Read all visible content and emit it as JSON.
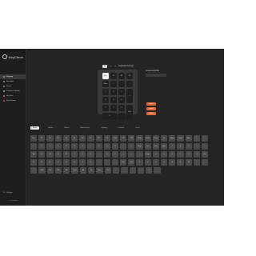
{
  "app": {
    "title": "KeyChron",
    "subtitle": "· · ·",
    "footer": "Connected"
  },
  "sidebar": {
    "items": [
      {
        "label": "Keymap",
        "active": true
      },
      {
        "label": "Backlight",
        "active": false
      },
      {
        "label": "Macro",
        "active": false
      },
      {
        "label": "Firmware Update",
        "active": false
      },
      {
        "label": "Key Test",
        "active": false
      },
      {
        "label": "Key Remap",
        "active": false
      }
    ],
    "settings_label": "Settings"
  },
  "toolbar": {
    "layer": "L0",
    "profile": "Keyboard Settings"
  },
  "numpad": {
    "keys": [
      {
        "label": "Esc",
        "selected": true,
        "tall": false,
        "wide": false
      },
      {
        "label": "F1",
        "selected": false,
        "tall": false,
        "wide": false
      },
      {
        "label": "F2",
        "selected": false,
        "tall": false,
        "wide": false
      },
      {
        "label": "F3",
        "selected": false,
        "tall": false,
        "wide": false
      },
      {
        "label": "Num",
        "selected": false,
        "tall": false,
        "wide": false
      },
      {
        "label": "/",
        "selected": false,
        "tall": false,
        "wide": false
      },
      {
        "label": "*",
        "selected": false,
        "tall": false,
        "wide": false
      },
      {
        "label": "-",
        "selected": false,
        "tall": false,
        "wide": false
      },
      {
        "label": "7",
        "selected": false,
        "tall": false,
        "wide": false
      },
      {
        "label": "8",
        "selected": false,
        "tall": false,
        "wide": false
      },
      {
        "label": "9",
        "selected": false,
        "tall": false,
        "wide": false
      },
      {
        "label": "+",
        "selected": false,
        "tall": true,
        "wide": false
      },
      {
        "label": "4",
        "selected": false,
        "tall": false,
        "wide": false
      },
      {
        "label": "5",
        "selected": false,
        "tall": false,
        "wide": false
      },
      {
        "label": "6",
        "selected": false,
        "tall": false,
        "wide": false
      },
      {
        "label": "1",
        "selected": false,
        "tall": false,
        "wide": false
      },
      {
        "label": "2",
        "selected": false,
        "tall": false,
        "wide": false
      },
      {
        "label": "3",
        "selected": false,
        "tall": false,
        "wide": false
      },
      {
        "label": "Ent",
        "selected": false,
        "tall": true,
        "wide": false
      },
      {
        "label": "0",
        "selected": false,
        "tall": false,
        "wide": true
      },
      {
        "label": ".",
        "selected": false,
        "tall": false,
        "wide": false
      }
    ]
  },
  "right_panel": {
    "label": "Current keycode",
    "buttons": [
      "Reset",
      "Import",
      "Export"
    ]
  },
  "tabs": [
    "Basic",
    "Media",
    "Macro",
    "Special Key",
    "Lighting",
    "Custom",
    "Layer"
  ],
  "keyboard": {
    "rows": [
      [
        "Esc",
        "F1",
        "F2",
        "F3",
        "F4",
        "F5",
        "F6",
        "F7",
        "F8",
        "F9",
        "F10",
        "F11",
        "F12",
        "PrtSc",
        "ScrLk",
        "Pause",
        "Ins",
        "Home",
        "PgUp",
        "Num",
        "/",
        "*"
      ],
      [
        "`",
        "1",
        "2",
        "3",
        "4",
        "5",
        "6",
        "7",
        "8",
        "9",
        "0",
        "-",
        "=",
        "Bksp",
        "Del",
        "End",
        "PgDn",
        "7",
        "8",
        "9",
        "-",
        "+"
      ],
      [
        "Tab",
        "Q",
        "W",
        "E",
        "R",
        "T",
        "Y",
        "U",
        "I",
        "O",
        "P",
        "[",
        "]",
        "\\",
        "Caps",
        "4",
        "5",
        "6",
        "1",
        "2",
        "3",
        "Ent"
      ],
      [
        "A",
        "S",
        "D",
        "F",
        "G",
        "H",
        "J",
        "K",
        "L",
        ";",
        "'",
        "Enter",
        "Shift",
        "Z",
        "X",
        "C",
        "V",
        "B",
        "N",
        "M",
        ",",
        "."
      ],
      [
        "/",
        "Shift",
        "Ctrl",
        "Win",
        "Alt",
        "Space",
        "Alt",
        "Fn",
        "Menu",
        "Ctrl",
        "←",
        "↑",
        "↓",
        "→",
        "0",
        "."
      ]
    ]
  }
}
